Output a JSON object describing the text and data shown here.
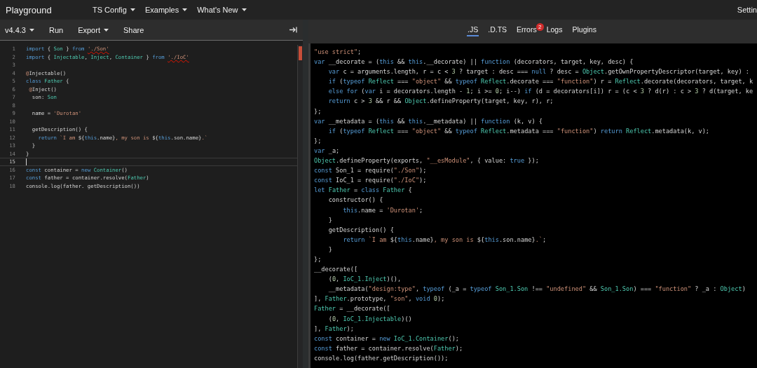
{
  "header": {
    "title": "Playground",
    "menus": [
      {
        "label": "TS Config",
        "dropdown": true
      },
      {
        "label": "Examples",
        "dropdown": true
      },
      {
        "label": "What's New",
        "dropdown": true
      }
    ],
    "settings": "Settin"
  },
  "editor": {
    "toolbar": {
      "buttons": [
        {
          "label": "v4.4.3",
          "dropdown": true
        },
        {
          "label": "Run",
          "dropdown": false
        },
        {
          "label": "Export",
          "dropdown": true
        },
        {
          "label": "Share",
          "dropdown": false
        }
      ]
    },
    "lines": [
      {
        "number": "1",
        "current": false,
        "code": [
          {
            "kind": "kw",
            "text": "import"
          },
          {
            "kind": "p",
            "text": " { "
          },
          {
            "kind": "ty",
            "text": "Son"
          },
          {
            "kind": "p",
            "text": " } "
          },
          {
            "kind": "kw",
            "text": "from "
          },
          {
            "kind": "err",
            "text": "'./Son'"
          }
        ]
      },
      {
        "number": "2",
        "current": false,
        "code": [
          {
            "kind": "kw",
            "text": "import"
          },
          {
            "kind": "p",
            "text": " { "
          },
          {
            "kind": "ty",
            "text": "Injectable"
          },
          {
            "kind": "p",
            "text": ", "
          },
          {
            "kind": "ty",
            "text": "Inject"
          },
          {
            "kind": "p",
            "text": ", "
          },
          {
            "kind": "ty",
            "text": "Container"
          },
          {
            "kind": "p",
            "text": " } "
          },
          {
            "kind": "kw",
            "text": "from "
          },
          {
            "kind": "err",
            "text": "'./IoC'"
          }
        ]
      },
      {
        "number": "3",
        "current": false
      },
      {
        "number": "4",
        "current": false,
        "code": [
          {
            "kind": "str",
            "text": "@"
          },
          {
            "kind": "p",
            "text": "Injectable()"
          }
        ]
      },
      {
        "number": "5",
        "current": false,
        "code": [
          {
            "kind": "kw",
            "text": "class "
          },
          {
            "kind": "ty",
            "text": "Father"
          },
          {
            "kind": "p",
            "text": " {"
          }
        ]
      },
      {
        "number": "6",
        "current": false,
        "code": [
          {
            "kind": "str",
            "text": " @"
          },
          {
            "kind": "p",
            "text": "Inject()"
          }
        ]
      },
      {
        "number": "7",
        "current": false,
        "code": [
          {
            "kind": "p",
            "text": "  son: "
          },
          {
            "kind": "ty",
            "text": "Son"
          }
        ]
      },
      {
        "number": "8",
        "current": false
      },
      {
        "number": "9",
        "current": false,
        "code": [
          {
            "kind": "p",
            "text": "  name = "
          },
          {
            "kind": "str",
            "text": "'Durotan'"
          }
        ]
      },
      {
        "number": "10",
        "current": false
      },
      {
        "number": "11",
        "current": false,
        "code": [
          {
            "kind": "p",
            "text": "  getDescription() {"
          }
        ]
      },
      {
        "number": "12",
        "current": false,
        "code": [
          {
            "kind": "kw",
            "text": "    return "
          },
          {
            "kind": "str",
            "text": "`I am "
          },
          {
            "kind": "p",
            "text": "${"
          },
          {
            "kind": "kw",
            "text": "this"
          },
          {
            "kind": "p",
            "text": ".name}"
          },
          {
            "kind": "str",
            "text": ", my son is "
          },
          {
            "kind": "p",
            "text": "${"
          },
          {
            "kind": "kw",
            "text": "this"
          },
          {
            "kind": "p",
            "text": ".son.name}"
          },
          {
            "kind": "str",
            "text": ".`"
          }
        ]
      },
      {
        "number": "13",
        "current": false,
        "code": [
          {
            "kind": "p",
            "text": "  }"
          }
        ]
      },
      {
        "number": "14",
        "current": false,
        "code": [
          {
            "kind": "p",
            "text": "}"
          }
        ]
      },
      {
        "number": "15",
        "current": true
      },
      {
        "number": "16",
        "current": false,
        "code": [
          {
            "kind": "kw",
            "text": "const"
          },
          {
            "kind": "p",
            "text": " container = "
          },
          {
            "kind": "kw",
            "text": "new "
          },
          {
            "kind": "ty",
            "text": "Container"
          },
          {
            "kind": "p",
            "text": "()"
          }
        ]
      },
      {
        "number": "17",
        "current": false,
        "code": [
          {
            "kind": "kw",
            "text": "const"
          },
          {
            "kind": "p",
            "text": " father = container.resolve("
          },
          {
            "kind": "ty",
            "text": "Father"
          },
          {
            "kind": "p",
            "text": ")"
          }
        ]
      },
      {
        "number": "18",
        "current": false,
        "code": [
          {
            "kind": "p",
            "text": "console.log(father. getDescription())"
          }
        ]
      }
    ]
  },
  "output": {
    "tabs": [
      {
        "label": ".JS",
        "selected": true
      },
      {
        "label": ".D.TS",
        "selected": false
      },
      {
        "label": "Errors",
        "selected": false,
        "badge": "2"
      },
      {
        "label": "Logs",
        "selected": false
      },
      {
        "label": "Plugins",
        "selected": false
      }
    ],
    "lines": [
      [
        {
          "kind": "str",
          "text": "\"use strict\""
        },
        {
          "kind": "p",
          "text": ";"
        }
      ],
      [
        {
          "kind": "kw",
          "text": "var"
        },
        {
          "kind": "p",
          "text": " __decorate = ("
        },
        {
          "kind": "kw",
          "text": "this"
        },
        {
          "kind": "p",
          "text": " && "
        },
        {
          "kind": "kw",
          "text": "this"
        },
        {
          "kind": "p",
          "text": ".__decorate) || "
        },
        {
          "kind": "kw",
          "text": "function"
        },
        {
          "kind": "p",
          "text": " (decorators, target, key, desc) {"
        }
      ],
      [
        {
          "kind": "kw",
          "text": "    var"
        },
        {
          "kind": "p",
          "text": " c = arguments.length, r = c < "
        },
        {
          "kind": "num",
          "text": "3"
        },
        {
          "kind": "p",
          "text": " ? target : desc === "
        },
        {
          "kind": "kw",
          "text": "null"
        },
        {
          "kind": "p",
          "text": " ? desc = "
        },
        {
          "kind": "ty",
          "text": "Object"
        },
        {
          "kind": "p",
          "text": ".getOwnPropertyDescriptor(target, key) :"
        }
      ],
      [
        {
          "kind": "kw",
          "text": "    if"
        },
        {
          "kind": "p",
          "text": " ("
        },
        {
          "kind": "kw",
          "text": "typeof "
        },
        {
          "kind": "ty",
          "text": "Reflect"
        },
        {
          "kind": "p",
          "text": " === "
        },
        {
          "kind": "str",
          "text": "\"object\""
        },
        {
          "kind": "p",
          "text": " && "
        },
        {
          "kind": "kw",
          "text": "typeof "
        },
        {
          "kind": "ty",
          "text": "Reflect"
        },
        {
          "kind": "p",
          "text": ".decorate === "
        },
        {
          "kind": "str",
          "text": "\"function\""
        },
        {
          "kind": "p",
          "text": ") r = "
        },
        {
          "kind": "ty",
          "text": "Reflect"
        },
        {
          "kind": "p",
          "text": ".decorate(decorators, target, k"
        }
      ],
      [
        {
          "kind": "kw",
          "text": "    else for"
        },
        {
          "kind": "p",
          "text": " ("
        },
        {
          "kind": "kw",
          "text": "var"
        },
        {
          "kind": "p",
          "text": " i = decorators.length - "
        },
        {
          "kind": "num",
          "text": "1"
        },
        {
          "kind": "p",
          "text": "; i >= "
        },
        {
          "kind": "num",
          "text": "0"
        },
        {
          "kind": "p",
          "text": "; i--) "
        },
        {
          "kind": "kw",
          "text": "if"
        },
        {
          "kind": "p",
          "text": " (d = decorators[i]) r = (c < "
        },
        {
          "kind": "num",
          "text": "3"
        },
        {
          "kind": "p",
          "text": " ? d(r) : c > "
        },
        {
          "kind": "num",
          "text": "3"
        },
        {
          "kind": "p",
          "text": " ? d(target, ke"
        }
      ],
      [
        {
          "kind": "kw",
          "text": "    return"
        },
        {
          "kind": "p",
          "text": " c > "
        },
        {
          "kind": "num",
          "text": "3"
        },
        {
          "kind": "p",
          "text": " && r && "
        },
        {
          "kind": "ty",
          "text": "Object"
        },
        {
          "kind": "p",
          "text": ".defineProperty(target, key, r), r;"
        }
      ],
      [
        {
          "kind": "p",
          "text": "};"
        }
      ],
      [
        {
          "kind": "kw",
          "text": "var"
        },
        {
          "kind": "p",
          "text": " __metadata = ("
        },
        {
          "kind": "kw",
          "text": "this"
        },
        {
          "kind": "p",
          "text": " && "
        },
        {
          "kind": "kw",
          "text": "this"
        },
        {
          "kind": "p",
          "text": ".__metadata) || "
        },
        {
          "kind": "kw",
          "text": "function"
        },
        {
          "kind": "p",
          "text": " (k, v) {"
        }
      ],
      [
        {
          "kind": "kw",
          "text": "    if"
        },
        {
          "kind": "p",
          "text": " ("
        },
        {
          "kind": "kw",
          "text": "typeof "
        },
        {
          "kind": "ty",
          "text": "Reflect"
        },
        {
          "kind": "p",
          "text": " === "
        },
        {
          "kind": "str",
          "text": "\"object\""
        },
        {
          "kind": "p",
          "text": " && "
        },
        {
          "kind": "kw",
          "text": "typeof "
        },
        {
          "kind": "ty",
          "text": "Reflect"
        },
        {
          "kind": "p",
          "text": ".metadata === "
        },
        {
          "kind": "str",
          "text": "\"function\""
        },
        {
          "kind": "p",
          "text": ") "
        },
        {
          "kind": "kw",
          "text": "return "
        },
        {
          "kind": "ty",
          "text": "Reflect"
        },
        {
          "kind": "p",
          "text": ".metadata(k, v);"
        }
      ],
      [
        {
          "kind": "p",
          "text": "};"
        }
      ],
      [
        {
          "kind": "kw",
          "text": "var"
        },
        {
          "kind": "p",
          "text": " _a;"
        }
      ],
      [
        {
          "kind": "ty",
          "text": "Object"
        },
        {
          "kind": "p",
          "text": ".defineProperty(exports, "
        },
        {
          "kind": "str",
          "text": "\"__esModule\""
        },
        {
          "kind": "p",
          "text": ", { value: "
        },
        {
          "kind": "kw",
          "text": "true"
        },
        {
          "kind": "p",
          "text": " });"
        }
      ],
      [
        {
          "kind": "kw",
          "text": "const"
        },
        {
          "kind": "p",
          "text": " Son_1 = require("
        },
        {
          "kind": "str",
          "text": "\"./Son\""
        },
        {
          "kind": "p",
          "text": ");"
        }
      ],
      [
        {
          "kind": "kw",
          "text": "const"
        },
        {
          "kind": "p",
          "text": " IoC_1 = require("
        },
        {
          "kind": "str",
          "text": "\"./IoC\""
        },
        {
          "kind": "p",
          "text": ");"
        }
      ],
      [
        {
          "kind": "kw",
          "text": "let "
        },
        {
          "kind": "ty",
          "text": "Father"
        },
        {
          "kind": "p",
          "text": " = "
        },
        {
          "kind": "kw",
          "text": "class "
        },
        {
          "kind": "ty",
          "text": "Father"
        },
        {
          "kind": "p",
          "text": " {"
        }
      ],
      [
        {
          "kind": "p",
          "text": "    constructor() {"
        }
      ],
      [
        {
          "kind": "kw",
          "text": "        this"
        },
        {
          "kind": "p",
          "text": ".name = "
        },
        {
          "kind": "str",
          "text": "'Durotan'"
        },
        {
          "kind": "p",
          "text": ";"
        }
      ],
      [
        {
          "kind": "p",
          "text": "    }"
        }
      ],
      [
        {
          "kind": "p",
          "text": "    getDescription() {"
        }
      ],
      [
        {
          "kind": "kw",
          "text": "        return "
        },
        {
          "kind": "str",
          "text": "`I am "
        },
        {
          "kind": "p",
          "text": "${"
        },
        {
          "kind": "kw",
          "text": "this"
        },
        {
          "kind": "p",
          "text": ".name}"
        },
        {
          "kind": "str",
          "text": ", my son is "
        },
        {
          "kind": "p",
          "text": "${"
        },
        {
          "kind": "kw",
          "text": "this"
        },
        {
          "kind": "p",
          "text": ".son.name}"
        },
        {
          "kind": "str",
          "text": ".`"
        },
        {
          "kind": "p",
          "text": ";"
        }
      ],
      [
        {
          "kind": "p",
          "text": "    }"
        }
      ],
      [
        {
          "kind": "p",
          "text": "};"
        }
      ],
      [
        {
          "kind": "p",
          "text": "__decorate(["
        }
      ],
      [
        {
          "kind": "p",
          "text": "    ("
        },
        {
          "kind": "num",
          "text": "0"
        },
        {
          "kind": "p",
          "text": ", "
        },
        {
          "kind": "ty",
          "text": "IoC_1.Inject"
        },
        {
          "kind": "p",
          "text": ")(),"
        }
      ],
      [
        {
          "kind": "p",
          "text": "    __metadata("
        },
        {
          "kind": "str",
          "text": "\"design:type\""
        },
        {
          "kind": "p",
          "text": ", "
        },
        {
          "kind": "kw",
          "text": "typeof"
        },
        {
          "kind": "p",
          "text": " (_a = "
        },
        {
          "kind": "kw",
          "text": "typeof "
        },
        {
          "kind": "ty",
          "text": "Son_1.Son"
        },
        {
          "kind": "p",
          "text": " !== "
        },
        {
          "kind": "str",
          "text": "\"undefined\""
        },
        {
          "kind": "p",
          "text": " && "
        },
        {
          "kind": "ty",
          "text": "Son_1.Son"
        },
        {
          "kind": "p",
          "text": ") === "
        },
        {
          "kind": "str",
          "text": "\"function\""
        },
        {
          "kind": "p",
          "text": " ? _a : "
        },
        {
          "kind": "ty",
          "text": "Object"
        },
        {
          "kind": "p",
          "text": ")"
        }
      ],
      [
        {
          "kind": "p",
          "text": "], "
        },
        {
          "kind": "ty",
          "text": "Father"
        },
        {
          "kind": "p",
          "text": ".prototype, "
        },
        {
          "kind": "str",
          "text": "\"son\""
        },
        {
          "kind": "p",
          "text": ", "
        },
        {
          "kind": "kw",
          "text": "void "
        },
        {
          "kind": "num",
          "text": "0"
        },
        {
          "kind": "p",
          "text": ");"
        }
      ],
      [
        {
          "kind": "ty",
          "text": "Father"
        },
        {
          "kind": "p",
          "text": " = __decorate(["
        }
      ],
      [
        {
          "kind": "p",
          "text": "    ("
        },
        {
          "kind": "num",
          "text": "0"
        },
        {
          "kind": "p",
          "text": ", "
        },
        {
          "kind": "ty",
          "text": "IoC_1.Injectable"
        },
        {
          "kind": "p",
          "text": ")()"
        }
      ],
      [
        {
          "kind": "p",
          "text": "], "
        },
        {
          "kind": "ty",
          "text": "Father"
        },
        {
          "kind": "p",
          "text": ");"
        }
      ],
      [
        {
          "kind": "kw",
          "text": "const"
        },
        {
          "kind": "p",
          "text": " container = "
        },
        {
          "kind": "kw",
          "text": "new "
        },
        {
          "kind": "ty",
          "text": "IoC_1.Container"
        },
        {
          "kind": "p",
          "text": "();"
        }
      ],
      [
        {
          "kind": "kw",
          "text": "const"
        },
        {
          "kind": "p",
          "text": " father = container.resolve("
        },
        {
          "kind": "ty",
          "text": "Father"
        },
        {
          "kind": "p",
          "text": ");"
        }
      ],
      [
        {
          "kind": "p",
          "text": "console.log(father.getDescription());"
        }
      ]
    ]
  }
}
